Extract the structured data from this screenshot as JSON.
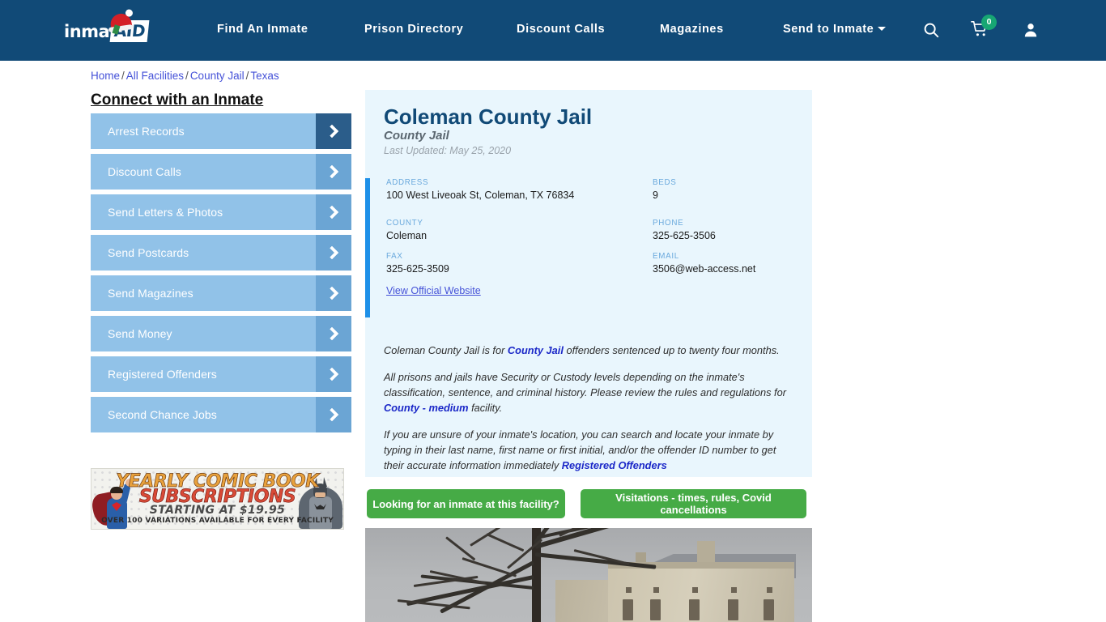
{
  "nav": {
    "logo": {
      "word1": "inmate",
      "word2": "AID"
    },
    "links": [
      {
        "label": "Find An Inmate"
      },
      {
        "label": "Prison Directory"
      },
      {
        "label": "Discount Calls"
      },
      {
        "label": "Magazines"
      },
      {
        "label": "Send to Inmate"
      }
    ],
    "cart_count": "0",
    "icons": [
      "search-icon",
      "cart-icon",
      "user-icon"
    ]
  },
  "breadcrumb": {
    "items": [
      {
        "label": "Home"
      },
      {
        "label": "All Facilities"
      },
      {
        "label": "County Jail"
      },
      {
        "label": "Texas"
      }
    ],
    "separator": "/"
  },
  "sidebar": {
    "title": "Connect with an Inmate",
    "items": [
      {
        "label": "Arrest Records"
      },
      {
        "label": "Discount Calls"
      },
      {
        "label": "Send Letters & Photos"
      },
      {
        "label": "Send Postcards"
      },
      {
        "label": "Send Magazines"
      },
      {
        "label": "Send Money"
      },
      {
        "label": "Registered Offenders"
      },
      {
        "label": "Second Chance Jobs"
      }
    ]
  },
  "ad": {
    "line1": "YEARLY COMIC BOOK",
    "line2": "SUBSCRIPTIONS",
    "line3": "STARTING AT $19.95",
    "line4": "OVER 100 VARIATIONS AVAILABLE FOR EVERY FACILITY"
  },
  "facility": {
    "name": "Coleman County Jail",
    "type": "County Jail",
    "last_updated": "Last Updated: May 25, 2020",
    "fields": {
      "address_label": "ADDRESS",
      "address_value": "100 West Liveoak St, Coleman, TX 76834",
      "beds_label": "BEDS",
      "beds_value": "9",
      "county_label": "COUNTY",
      "county_value": "Coleman",
      "phone_label": "PHONE",
      "phone_value": "325-625-3506",
      "fax_label": "FAX",
      "fax_value": "325-625-3509",
      "email_label": "EMAIL",
      "email_value": "3506@web-access.net"
    },
    "official_website_link": "View Official Website"
  },
  "description": {
    "p1_a": "Coleman County Jail is for ",
    "p1_link": "County Jail",
    "p1_b": " offenders sentenced up to twenty four months.",
    "p2_a": "All prisons and jails have Security or Custody levels depending on the inmate's classification, sentence, and criminal history. Please review the rules and regulations for ",
    "p2_link": "County - medium",
    "p2_b": " facility.",
    "p3_a": "If you are unsure of your inmate's location, you can search and locate your inmate by typing in their last name, first name or first initial, and/or the offender ID number to get their accurate information immediately ",
    "p3_link": "Registered Offenders"
  },
  "actions": {
    "find_inmate": "Looking for an inmate at this facility?",
    "visitations": "Visitations - times, rules, Covid cancellations"
  },
  "colors": {
    "nav_blue": "#114a77",
    "card_blue": "#e9f6fd",
    "accent_bar": "#1e90e8",
    "green_button": "#46ab46",
    "sidebar_blue": "#91c2e8",
    "badge_green": "#17a673"
  }
}
